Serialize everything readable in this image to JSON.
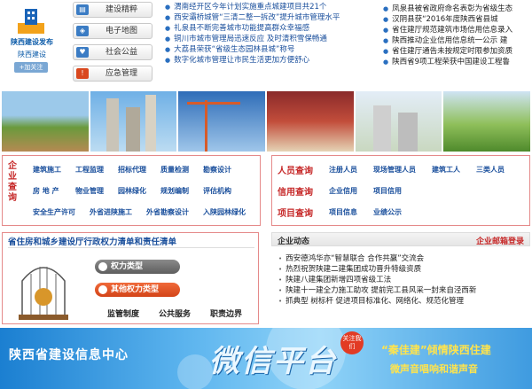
{
  "logo": {
    "title": "陕西建设发布",
    "subtitle": "陕西建设",
    "follow": "+加关注"
  },
  "quick_links": [
    {
      "label": "建设精粹",
      "icon": "book-icon"
    },
    {
      "label": "电子地图",
      "icon": "map-icon"
    },
    {
      "label": "社会公益",
      "icon": "heart-icon"
    },
    {
      "label": "应急管理",
      "icon": "alert-icon"
    }
  ],
  "news_center": [
    "渭南经开区今年计划实施重点城建项目共21个",
    "西安灞桥城管“三清二整一拆改”提升城市管理水平",
    "礼泉县不断完善城市功能提高群众幸福感",
    "铜川市城市管理局迅速反应 及时清积雪保畅通",
    "大荔县荣获“省级生态园林县城”称号",
    "数字化城市管理让市民生活更加方便舒心"
  ],
  "news_right": [
    "凤泉县被省政府命名表彰为省级生态",
    "汉阴县获“2016年度陕西省县城",
    "省住建厅规范建筑市场信用信息录入",
    "陕西推动企业信用信息统一公示 建",
    "省住建厅通告未按规定时限参加资质",
    "陕西省9项工程荣获中国建设工程鲁"
  ],
  "enterprise_query": {
    "label": "企业查询",
    "rows": [
      [
        "建筑施工",
        "工程监理",
        "招标代理",
        "质量检测",
        "勘察设计"
      ],
      [
        "房 地 产",
        "物业管理",
        "园林绿化",
        "规划编制",
        "评估机构"
      ],
      [
        "安全生产许可",
        "外省进陕施工",
        "外省勘察设计",
        "入陕园林绿化"
      ]
    ]
  },
  "person_query": {
    "label": "人员查询",
    "items": [
      "注册人员",
      "现场管理人员",
      "建筑工人",
      "三类人员"
    ]
  },
  "credit_query": {
    "label": "信用查询",
    "items": [
      "企业信用",
      "项目信用"
    ]
  },
  "project_query": {
    "label": "项目查询",
    "items": [
      "项目信息",
      "业绩公示"
    ]
  },
  "power_list": {
    "title": "省住房和城乡建设厅行政权力清单和责任清单",
    "pill1": "权力类型",
    "pill2": "其他权力类型",
    "links": [
      "监管制度",
      "公共服务",
      "职责边界"
    ]
  },
  "enterprise_news": {
    "title": "企业动态",
    "mailbox": "企业邮箱登录",
    "items": [
      "西安德鸿华亦“智慧联合 合作共赢”交流会",
      "热烈祝贺陕建二建集团成功晋升特级资质",
      "陕建八建集团新增四项省级工法",
      "陕建十一建全力施工助攻 提前完工县风采一封来自泾西新",
      "抓典型 树标杆 促进项目标准化、网络化、规范化管理"
    ]
  },
  "banner": {
    "left": "陕西省建设信息中心",
    "center": "微信平台",
    "badge": "关注我们",
    "slogan1": "“秦佳建”倾情陕西住建",
    "slogan2": "微声音唱响和谐声音"
  }
}
